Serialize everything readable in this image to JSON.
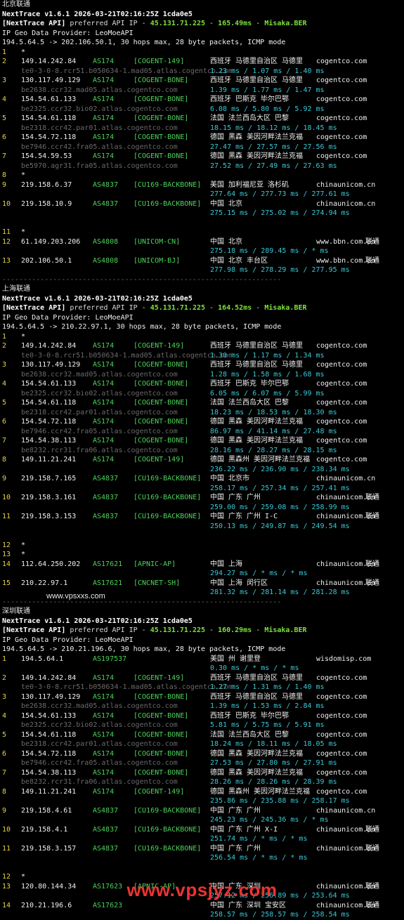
{
  "sections": [
    {
      "caption": "北京联通",
      "header": "NextTrace v1.6.1 2026-03-21T02:16:25Z 1cda0e5",
      "api_prefix": "[NextTrace API]",
      "api_mid": " preferred API IP - ",
      "api_ip": "45.131.71.225",
      "api_sep1": " - ",
      "api_ms": "165.49ms",
      "api_sep2": " - ",
      "api_node": "Misaka.BER",
      "geo": "IP Geo Data Provider: LeoMoeAPI",
      "route": "194.5.64.5 -> 202.106.50.1, 30 hops max, 28 byte packets, ICMP mode",
      "hops": [
        {
          "n": "1",
          "star": true
        },
        {
          "n": "2",
          "ip": "149.14.242.84",
          "as": "AS174",
          "tag": "[COGENT-149]",
          "geo": "西班牙 马德里自治区 马德里",
          "host": "cogentco.com",
          "rdns": "te0-3-0-8.rcr51.b050634-1.mad05.atlas.cogentco.com",
          "rtt": "1.23 ms / 1.07 ms / 1.40 ms"
        },
        {
          "n": "3",
          "ip": "130.117.49.129",
          "as": "AS174",
          "tag": "[COGENT-BONE]",
          "geo": "西班牙 马德里自治区 马德里",
          "host": "cogentco.com",
          "rdns": "be2638.ccr32.mad05.atlas.cogentco.com",
          "rtt": "1.39 ms / 1.77 ms / 1.47 ms"
        },
        {
          "n": "4",
          "ip": "154.54.61.133",
          "as": "AS174",
          "tag": "[COGENT-BONE]",
          "geo": "西班牙 巴斯克 毕尔巴鄂",
          "host": "cogentco.com",
          "rdns": "be2325.ccr32.bio02.atlas.cogentco.com",
          "rtt": "6.08 ms / 5.80 ms / 5.92 ms"
        },
        {
          "n": "5",
          "ip": "154.54.61.118",
          "as": "AS174",
          "tag": "[COGENT-BONE]",
          "geo": "法国 法兰西岛大区 巴黎",
          "host": "cogentco.com",
          "rdns": "be2318.ccr42.par01.atlas.cogentco.com",
          "rtt": "18.15 ms / 18.12 ms / 18.45 ms"
        },
        {
          "n": "6",
          "ip": "154.54.72.118",
          "as": "AS174",
          "tag": "[COGENT-BONE]",
          "geo": "德国 黑森 美因河畔法兰克福",
          "host": "cogentco.com",
          "rdns": "be7946.ccr42.fra05.atlas.cogentco.com",
          "rtt": "27.47 ms / 27.57 ms / 27.56 ms"
        },
        {
          "n": "7",
          "ip": "154.54.59.53",
          "as": "AS174",
          "tag": "[COGENT-BONE]",
          "geo": "德国 黑森 美因河畔法兰克福",
          "host": "cogentco.com",
          "rdns": "be5970.agr31.fra05.atlas.cogentco.com",
          "rtt": "27.52 ms / 27.49 ms / 27.63 ms"
        },
        {
          "n": "8",
          "star": true
        },
        {
          "n": "9",
          "ip": "219.158.6.37",
          "as": "AS4837",
          "tag": "[CU169-BACKBONE]",
          "geo": "美国 加利福尼亚 洛杉矶",
          "host": "chinaunicom.cn",
          "rtt": "277.64 ms / 277.73 ms / 277.61 ms"
        },
        {
          "n": "10",
          "ip": "219.158.10.9",
          "as": "AS4837",
          "tag": "[CU169-BACKBONE]",
          "geo": "中国 北京",
          "host": "chinaunicom.cn",
          "rtt": "275.15 ms / 275.02 ms / 274.94 ms",
          "gap_after": true
        },
        {
          "n": "11",
          "star": true
        },
        {
          "n": "12",
          "ip": "61.149.203.206",
          "as": "AS4808",
          "tag": "[UNICOM-CN]",
          "geo": "中国 北京",
          "host": "www.bbn.com.cn",
          "isp": "联通",
          "rtt": "275.18 ms / 289.45 ms / * ms"
        },
        {
          "n": "13",
          "ip": "202.106.50.1",
          "as": "AS4808",
          "tag": "[UNICOM-BJ]",
          "geo": "中国 北京 丰台区",
          "host": "www.bbn.com.cn",
          "isp": "联通",
          "rtt": "277.98 ms / 278.29 ms / 277.95 ms"
        }
      ]
    },
    {
      "caption": "上海联通",
      "header": "NextTrace v1.6.1 2026-03-21T02:16:25Z 1cda0e5",
      "api_prefix": "[NextTrace API]",
      "api_mid": " preferred API IP - ",
      "api_ip": "45.131.71.225",
      "api_sep1": " - ",
      "api_ms": "164.52ms",
      "api_sep2": " - ",
      "api_node": "Misaka.BER",
      "geo": "IP Geo Data Provider: LeoMoeAPI",
      "route": "194.5.64.5 -> 210.22.97.1, 30 hops max, 28 byte packets, ICMP mode",
      "hops": [
        {
          "n": "1",
          "star": true
        },
        {
          "n": "2",
          "ip": "149.14.242.84",
          "as": "AS174",
          "tag": "[COGENT-149]",
          "geo": "西班牙 马德里自治区 马德里",
          "host": "cogentco.com",
          "rdns": "te0-3-0-8.rcr51.b050634-1.mad05.atlas.cogentco.com",
          "rtt": "1.30 ms / 1.17 ms / 1.34 ms"
        },
        {
          "n": "3",
          "ip": "130.117.49.129",
          "as": "AS174",
          "tag": "[COGENT-BONE]",
          "geo": "西班牙 马德里自治区 马德里",
          "host": "cogentco.com",
          "rdns": "be2638.ccr32.mad05.atlas.cogentco.com",
          "rtt": "1.28 ms / 1.58 ms / 1.68 ms"
        },
        {
          "n": "4",
          "ip": "154.54.61.133",
          "as": "AS174",
          "tag": "[COGENT-BONE]",
          "geo": "西班牙 巴斯克 毕尔巴鄂",
          "host": "cogentco.com",
          "rdns": "be2325.ccr32.bio02.atlas.cogentco.com",
          "rtt": "6.05 ms / 6.07 ms / 5.99 ms"
        },
        {
          "n": "5",
          "ip": "154.54.61.118",
          "as": "AS174",
          "tag": "[COGENT-BONE]",
          "geo": "法国 法兰西岛大区 巴黎",
          "host": "cogentco.com",
          "rdns": "be2318.ccr42.par01.atlas.cogentco.com",
          "rtt": "18.23 ms / 18.53 ms / 18.30 ms"
        },
        {
          "n": "6",
          "ip": "154.54.72.118",
          "as": "AS174",
          "tag": "[COGENT-BONE]",
          "geo": "德国 黑森 美因河畔法兰克福",
          "host": "cogentco.com",
          "rdns": "be7946.ccr42.fra05.atlas.cogentco.com",
          "rtt": "86.97 ms / 41.14 ms / 27.48 ms"
        },
        {
          "n": "7",
          "ip": "154.54.38.113",
          "as": "AS174",
          "tag": "[COGENT-BONE]",
          "geo": "德国 黑森 美因河畔法兰克福",
          "host": "cogentco.com",
          "rdns": "be8232.rcr31.fra06.atlas.cogentco.com",
          "rtt": "28.16 ms / 28.27 ms / 28.15 ms"
        },
        {
          "n": "8",
          "ip": "149.11.21.241",
          "as": "AS174",
          "tag": "[COGENT-149]",
          "geo": "德国 黑森州 美因河畔法兰克福",
          "host": "cogentco.com",
          "rtt": "236.22 ms / 236.90 ms / 238.34 ms"
        },
        {
          "n": "9",
          "ip": "219.158.7.165",
          "as": "AS4837",
          "tag": "[CU169-BACKBONE]",
          "geo": "中国 北京市",
          "host": "chinaunicom.cn",
          "rtt": "258.17 ms / 257.34 ms / 257.41 ms"
        },
        {
          "n": "10",
          "ip": "219.158.3.161",
          "as": "AS4837",
          "tag": "[CU169-BACKBONE]",
          "geo": "中国 广东 广州",
          "host": "chinaunicom.cn",
          "isp": "联通",
          "rtt": "259.00 ms / 259.08 ms / 258.99 ms"
        },
        {
          "n": "11",
          "ip": "219.158.3.153",
          "as": "AS4837",
          "tag": "[CU169-BACKBONE]",
          "geo": "中国 广东 广州 I-C",
          "host": "chinaunicom.cn",
          "isp": "联通",
          "rtt": "250.13 ms / 249.87 ms / 249.54 ms",
          "gap_after": true
        },
        {
          "n": "12",
          "star": true
        },
        {
          "n": "13",
          "star": true
        },
        {
          "n": "14",
          "ip": "112.64.250.202",
          "as": "AS17621",
          "tag": "[APNIC-AP]",
          "geo": "中国 上海",
          "host": "chinaunicom.cn",
          "isp": "联通",
          "rtt": "294.27 ms / * ms / * ms"
        },
        {
          "n": "15",
          "ip": "210.22.97.1",
          "as": "AS17621",
          "tag": "[CNCNET-SH]",
          "geo": "中国 上海 闵行区",
          "host": "chinaunicom.cn",
          "isp": "联通",
          "rtt": "281.32 ms / 281.14 ms / 281.28 ms"
        }
      ]
    },
    {
      "caption": "深圳联通",
      "header": "NextTrace v1.6.1 2026-03-21T02:16:25Z 1cda0e5",
      "api_prefix": "[NextTrace API]",
      "api_mid": " preferred API IP - ",
      "api_ip": "45.131.71.225",
      "api_sep1": " - ",
      "api_ms": "160.29ms",
      "api_sep2": " - ",
      "api_node": "Misaka.BER",
      "geo": "IP Geo Data Provider: LeoMoeAPI",
      "route": "194.5.64.5 -> 210.21.196.6, 30 hops max, 28 byte packets, ICMP mode",
      "hops": [
        {
          "n": "1",
          "ip": "194.5.64.1",
          "as": "AS197537",
          "tag": "",
          "geo": "美国 州 谢里登",
          "host": "wisdomisp.com",
          "rtt": "0.30 ms / * ms / * ms"
        },
        {
          "n": "2",
          "ip": "149.14.242.84",
          "as": "AS174",
          "tag": "[COGENT-149]",
          "geo": "西班牙 马德里自治区 马德里",
          "host": "cogentco.com",
          "rdns": "te0-3-0-8.rcr51.b050634-1.mad05.atlas.cogentco.com",
          "rtt": "1.27 ms / 1.31 ms / 1.40 ms"
        },
        {
          "n": "3",
          "ip": "130.117.49.129",
          "as": "AS174",
          "tag": "[COGENT-BONE]",
          "geo": "西班牙 马德里自治区 马德里",
          "host": "cogentco.com",
          "rdns": "be2638.ccr32.mad05.atlas.cogentco.com",
          "rtt": "1.39 ms / 1.53 ms / 2.84 ms"
        },
        {
          "n": "4",
          "ip": "154.54.61.133",
          "as": "AS174",
          "tag": "[COGENT-BONE]",
          "geo": "西班牙 巴斯克 毕尔巴鄂",
          "host": "cogentco.com",
          "rdns": "be2325.ccr32.bio02.atlas.cogentco.com",
          "rtt": "5.81 ms / 5.75 ms / 5.91 ms"
        },
        {
          "n": "5",
          "ip": "154.54.61.118",
          "as": "AS174",
          "tag": "[COGENT-BONE]",
          "geo": "法国 法兰西岛大区 巴黎",
          "host": "cogentco.com",
          "rdns": "be2318.ccr42.par01.atlas.cogentco.com",
          "rtt": "18.24 ms / 18.11 ms / 18.05 ms"
        },
        {
          "n": "6",
          "ip": "154.54.72.118",
          "as": "AS174",
          "tag": "[COGENT-BONE]",
          "geo": "德国 黑森 美因河畔法兰克福",
          "host": "cogentco.com",
          "rdns": "be7946.ccr42.fra05.atlas.cogentco.com",
          "rtt": "27.53 ms / 27.80 ms / 27.91 ms"
        },
        {
          "n": "7",
          "ip": "154.54.38.113",
          "as": "AS174",
          "tag": "[COGENT-BONE]",
          "geo": "德国 黑森 美因河畔法兰克福",
          "host": "cogentco.com",
          "rdns": "be8232.rcr31.fra06.atlas.cogentco.com",
          "rtt": "28.26 ms / 28.26 ms / 28.39 ms"
        },
        {
          "n": "8",
          "ip": "149.11.21.241",
          "as": "AS174",
          "tag": "[COGENT-149]",
          "geo": "德国 黑森州 美因河畔法兰克福",
          "host": "cogentco.com",
          "rtt": "235.86 ms / 235.88 ms / 258.17 ms"
        },
        {
          "n": "9",
          "ip": "219.158.4.61",
          "as": "AS4837",
          "tag": "[CU169-BACKBONE]",
          "geo": "中国 广东 广州",
          "host": "chinaunicom.cn",
          "rtt": "245.23 ms / 245.36 ms / * ms"
        },
        {
          "n": "10",
          "ip": "219.158.4.1",
          "as": "AS4837",
          "tag": "[CU169-BACKBONE]",
          "geo": "中国 广东 广州 X-I",
          "host": "chinaunicom.cn",
          "isp": "联通",
          "rtt": "251.74 ms / * ms / * ms"
        },
        {
          "n": "11",
          "ip": "219.158.3.157",
          "as": "AS4837",
          "tag": "[CU169-BACKBONE]",
          "geo": "中国 广东 广州",
          "host": "chinaunicom.cn",
          "isp": "联通",
          "rtt": "256.54 ms / * ms / * ms",
          "gap_after": true
        },
        {
          "n": "12",
          "star": true
        },
        {
          "n": "13",
          "ip": "120.80.144.34",
          "as": "AS17623",
          "tag": "[APNIC-AP]",
          "geo": "中国 广东 深圳",
          "host": "chinaunicom.cn",
          "isp": "联通",
          "rtt": "257.12 ms / 256.89 ms / 253.64 ms"
        },
        {
          "n": "14",
          "ip": "210.21.196.6",
          "as": "AS17623",
          "tag": "",
          "geo": "中国 广东 深圳 宝安区",
          "host": "chinaunicom.cn",
          "isp": "联通",
          "rtt": "258.57 ms / 258.57 ms / 258.54 ms"
        }
      ]
    }
  ],
  "separator": "------------------------------------------------------------------",
  "watermark_small": "www.vpsxxs.com",
  "watermark_main": "www.vpsjyz.com"
}
